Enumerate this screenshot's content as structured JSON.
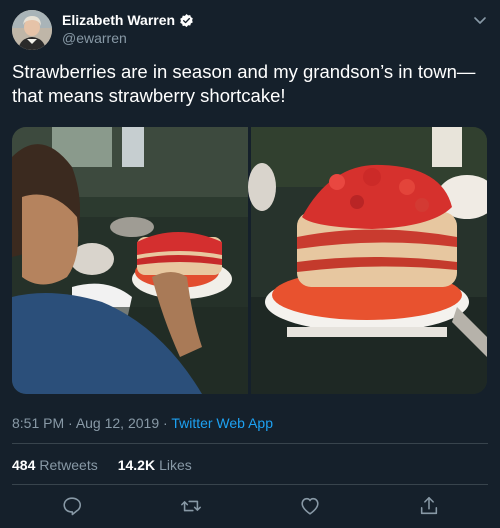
{
  "author": {
    "name": "Elizabeth Warren",
    "handle": "@ewarren",
    "verified": true
  },
  "tweet": {
    "text": "Strawberries are in season and my grandson’s in town—that means strawberry shortcake!",
    "time": "8:51 PM",
    "date": "Aug 12, 2019",
    "separator": " · ",
    "app": "Twitter Web App"
  },
  "stats": {
    "retweets_count": "484",
    "retweets_label": "Retweets",
    "likes_count": "14.2K",
    "likes_label": "Likes"
  },
  "colors": {
    "background": "#15202b",
    "secondary_text": "#8899a6",
    "link": "#1da1f2",
    "divider": "#38444d"
  },
  "icons": [
    "verified-badge-icon",
    "chevron-down-icon",
    "reply-icon",
    "retweet-icon",
    "like-icon",
    "share-icon"
  ]
}
